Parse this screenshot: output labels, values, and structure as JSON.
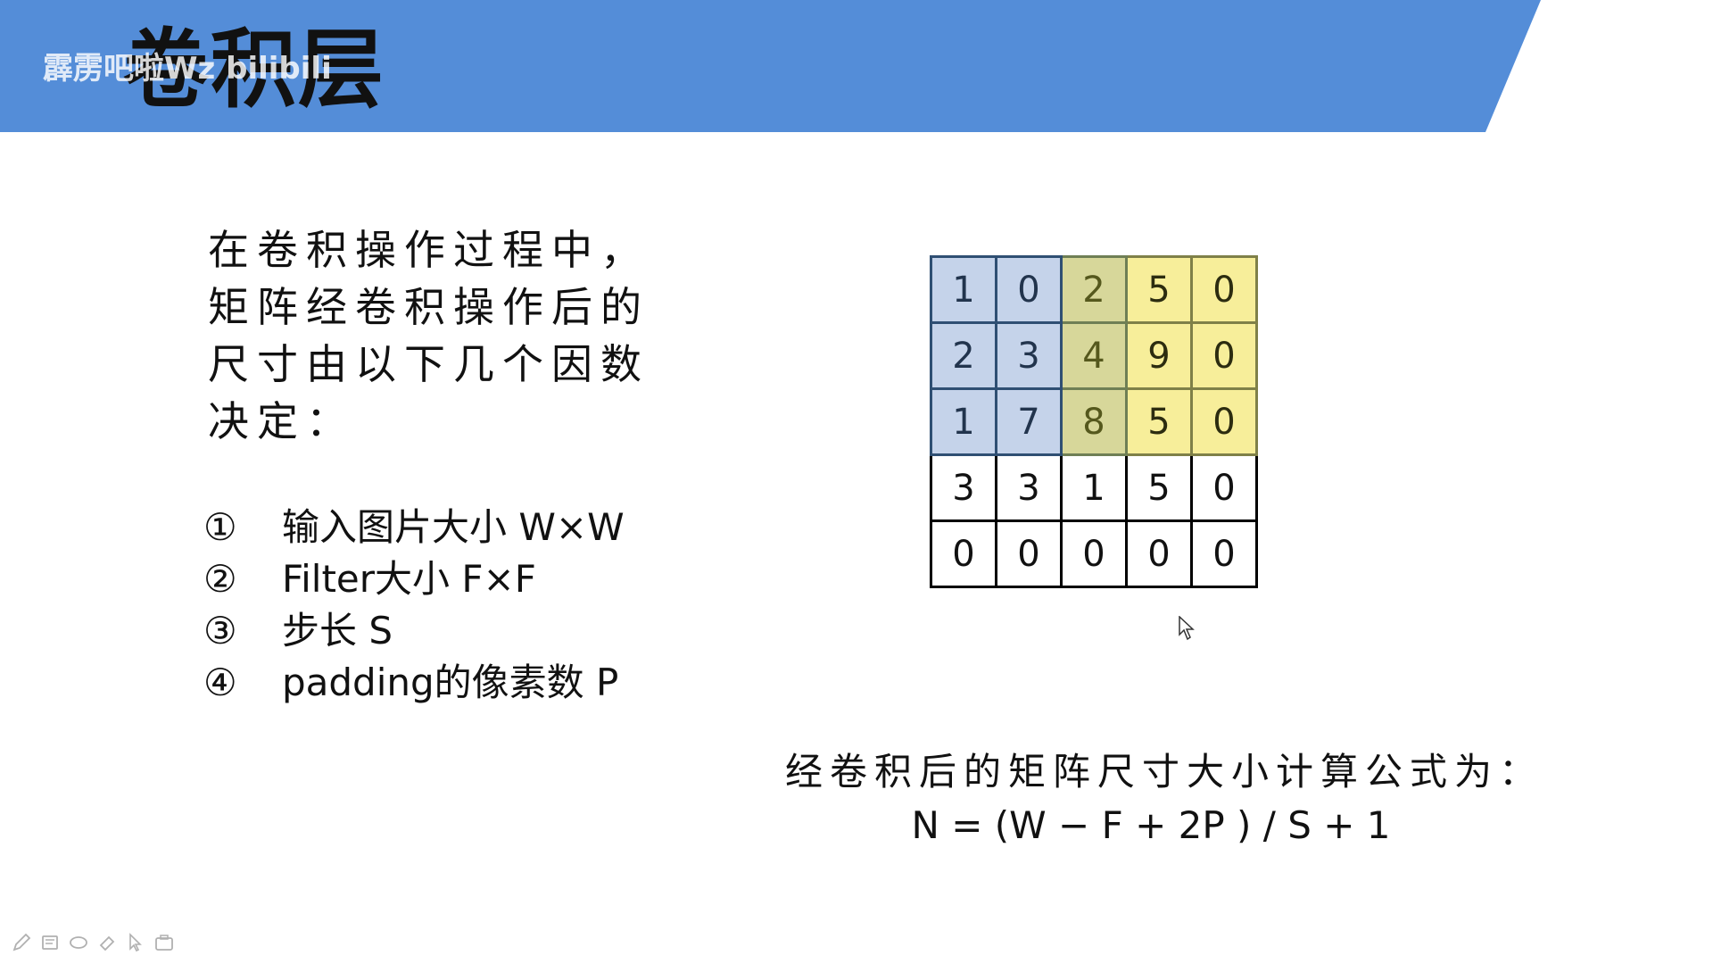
{
  "slide": {
    "title": "卷积层",
    "watermark": "霹雳吧啦Wz bilibili"
  },
  "intro": {
    "lines": [
      "在卷积操作过程中，",
      "矩阵经卷积操作后的",
      "尺寸由以下几个因数",
      "决定："
    ]
  },
  "factors": [
    {
      "number": "①",
      "text": "输入图片大小 W×W"
    },
    {
      "number": "②",
      "text": "Filter大小 F×F"
    },
    {
      "number": "③",
      "text": "步长 S"
    },
    {
      "number": "④",
      "text": "padding的像素数 P"
    }
  ],
  "matrix": {
    "rows": [
      [
        "1",
        "0",
        "2",
        "5",
        "0"
      ],
      [
        "2",
        "3",
        "4",
        "9",
        "0"
      ],
      [
        "1",
        "7",
        "8",
        "5",
        "0"
      ],
      [
        "3",
        "3",
        "1",
        "5",
        "0"
      ],
      [
        "0",
        "0",
        "0",
        "0",
        "0"
      ]
    ],
    "highlight_colors": {
      "blue_region": "#c5d3ea",
      "overlap_region": "#d7d79a",
      "yellow_region": "#f7ee9a"
    }
  },
  "formula": {
    "label": "经卷积后的矩阵尺寸大小计算公式为：",
    "equation": "N = (W − F + 2P ) / S + 1"
  },
  "colors": {
    "title_bar": "#548dd8",
    "background": "#ffffff",
    "text": "#111111"
  },
  "icons": {
    "cursor": "mouse-pointer-icon",
    "toolbar": [
      "pen-icon",
      "highlighter-icon",
      "eraser-icon",
      "laser-pointer-icon",
      "arrow-icon",
      "camera-icon"
    ]
  }
}
